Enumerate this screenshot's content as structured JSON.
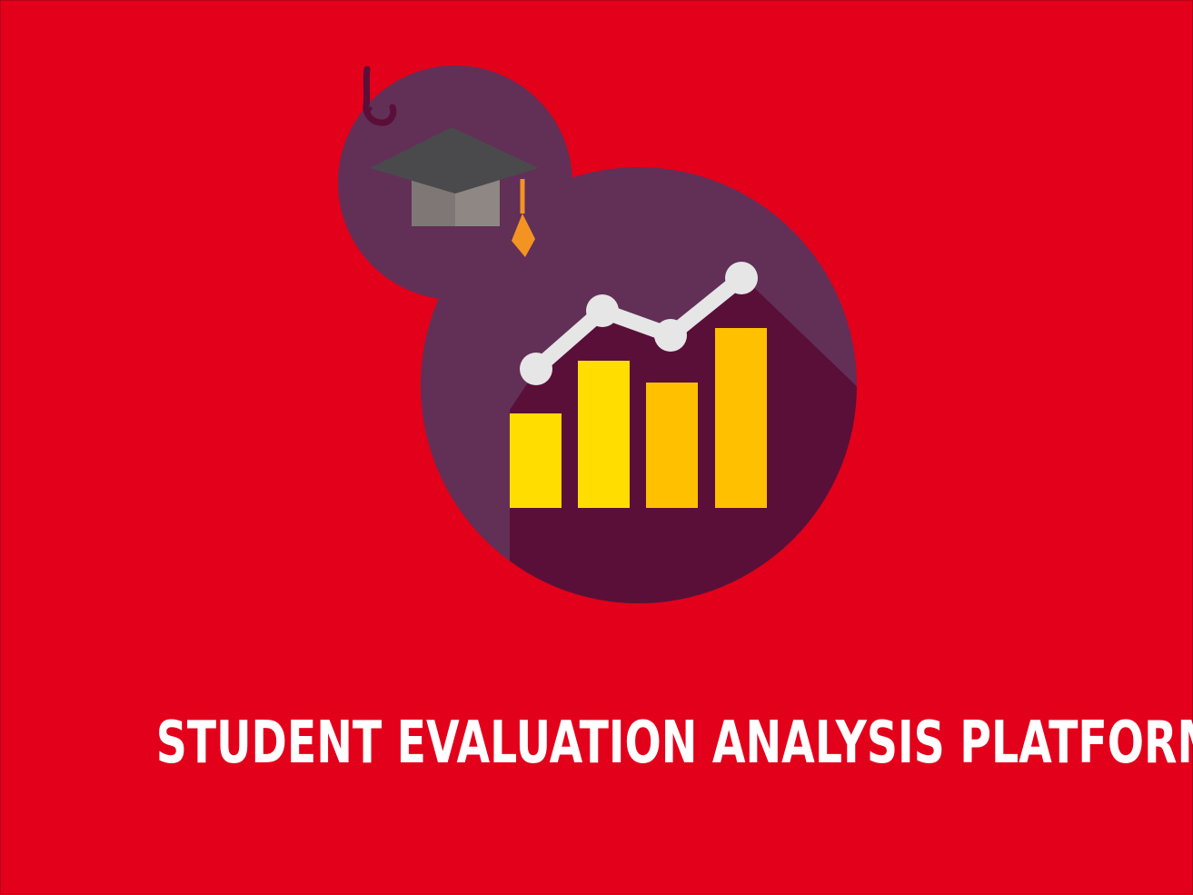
{
  "title": "STUDENT EVALUATION ANALYSIS PLATFORM",
  "colors": {
    "background": "#e3001b",
    "circle_purple": "#622f57",
    "shadow_maroon": "#5a0f38",
    "cap_dark": "#4a4a4c",
    "cap_light": "#8e8784",
    "tassel": "#f39422",
    "bar_yellow": "#ffdd00",
    "bar_amber": "#ffc000",
    "trend_line": "#e6e6e6",
    "text": "#ffffff"
  },
  "icons": [
    "graduation-cap-icon",
    "bar-chart-icon",
    "trend-line-icon"
  ]
}
